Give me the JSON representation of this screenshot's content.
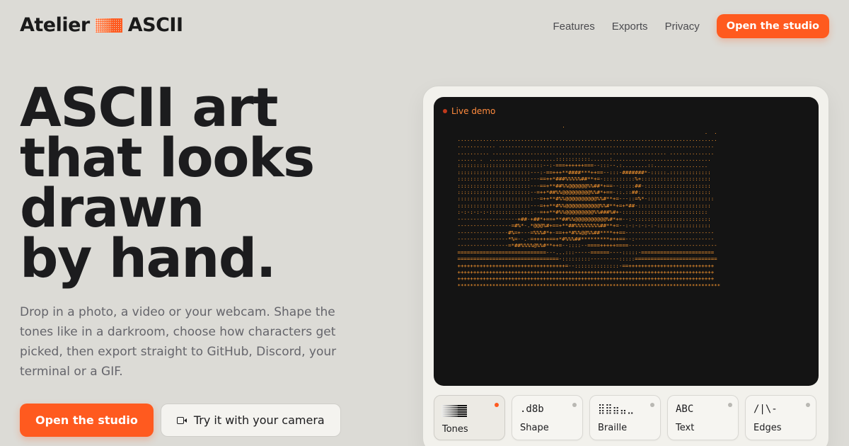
{
  "brand": {
    "name_left": "Atelier",
    "name_right": "ASCII"
  },
  "nav": {
    "links": [
      "Features",
      "Exports",
      "Privacy"
    ],
    "cta": "Open the studio"
  },
  "hero": {
    "title_lines": [
      "ASCII art",
      "that looks",
      "drawn",
      "by hand."
    ],
    "description": "Drop in a photo, a video or your webcam. Shape the tones like in a darkroom, choose how characters get picked, then export straight to GitHub, Discord, your terminal or a GIF.",
    "primary_cta": "Open the studio",
    "secondary_cta": "Try it with your camera"
  },
  "demo": {
    "badge": "Live demo",
    "ascii_lines": [
      "                                  .                                                 ",
      "                                                                               .  . ",
      " ..................................................................................",
      " ............ .................................................................... ",
      " .......... ....................................................... .............. ",
      " ...... .  .....................:::::::::::......:............................... ",
      " :::::::::::::::::::::::::::--:-===++++++===--:::--.:........::................. ",
      " :::::::::::::::::::::::---:-==+++**####***++==--:::-#######*-:::::.::::::::::::: ",
      " :::::::::::::::::::::::---==++*###%%%%%##**+=-::::::::::%+:::::::::::::::::::::: ",
      " :::::::::::::::::::::::---==+**##%%@@@@@@%%##*+==--:::::##-::::::::::::::::::::: ",
      " :::::::::::::::::::::::--=++*##%%@@@@@@@@@%%#*+==-::.::##::::::::::::::::::::::: ",
      " ::::::::::::::::::::::::--=++**#%%@@@@@@@@@@%%#**+=---::=%*-::::::::::::::::::::: ",
      " :::::::::::::::::::::::---=++**#%%@@@@@@@@@@@%%#**+=+*##-::::::::::::::::::::::: ",
      " :-:-:-:-:-::::::::::::::--=++**#%%@@@@@@@@@%%###%#+-::::::::::::::::::::::::::: ",
      " -------------------+##-+##*+==+**##%%@@@@@@@@@@%#*+=--:-:::::::::::::::::::::::: ",
      " -----------------=#%*-.*@@@%#+==+**##%%%%%%%%##**+=--:-:-:-:-:-::::::::::::::::: ",
      " ----------------#%=+---=%%%#*+-==++*#%%@@%%##****++==---------------------------- ",
      " ----------------*%=--.-=+++++==+*#%%%##*********+++==--:------------------------- ",
      " ----------------=*##%%%%@%%#**++=--::::--====+++++====---------------------------- ",
      " ============================---...:::-----======----:::::-======================= ",
      " ================================-:::::::::---------:::::========================== ",
      " ++++++++++++++++++++++++++++++++++=--::::::::::::::-==+++++++++++++++++++++++++++ ",
      " +++++++++++++++++++++++++++++++++++++++++++++++++++++++++++++++++++++++++++++++++ ",
      " +++++++++++++++++++++++++++++++++++++++++++++++++++++++++++++++++++++++++++++++++ ",
      " *********************************************************************************** "
    ]
  },
  "modes": [
    {
      "glyph": "",
      "label": "Tones",
      "active": true
    },
    {
      "glyph": ".d8b",
      "label": "Shape",
      "active": false
    },
    {
      "glyph": "⣿⣿⣶⣤⣀",
      "label": "Braille",
      "active": false
    },
    {
      "glyph": "ABC",
      "label": "Text",
      "active": false
    },
    {
      "glyph": "/|\\-",
      "label": "Edges",
      "active": false
    }
  ],
  "colors": {
    "accent": "#ff5a1f",
    "background": "#dcdbd6",
    "ascii": "#ff9a2f"
  }
}
